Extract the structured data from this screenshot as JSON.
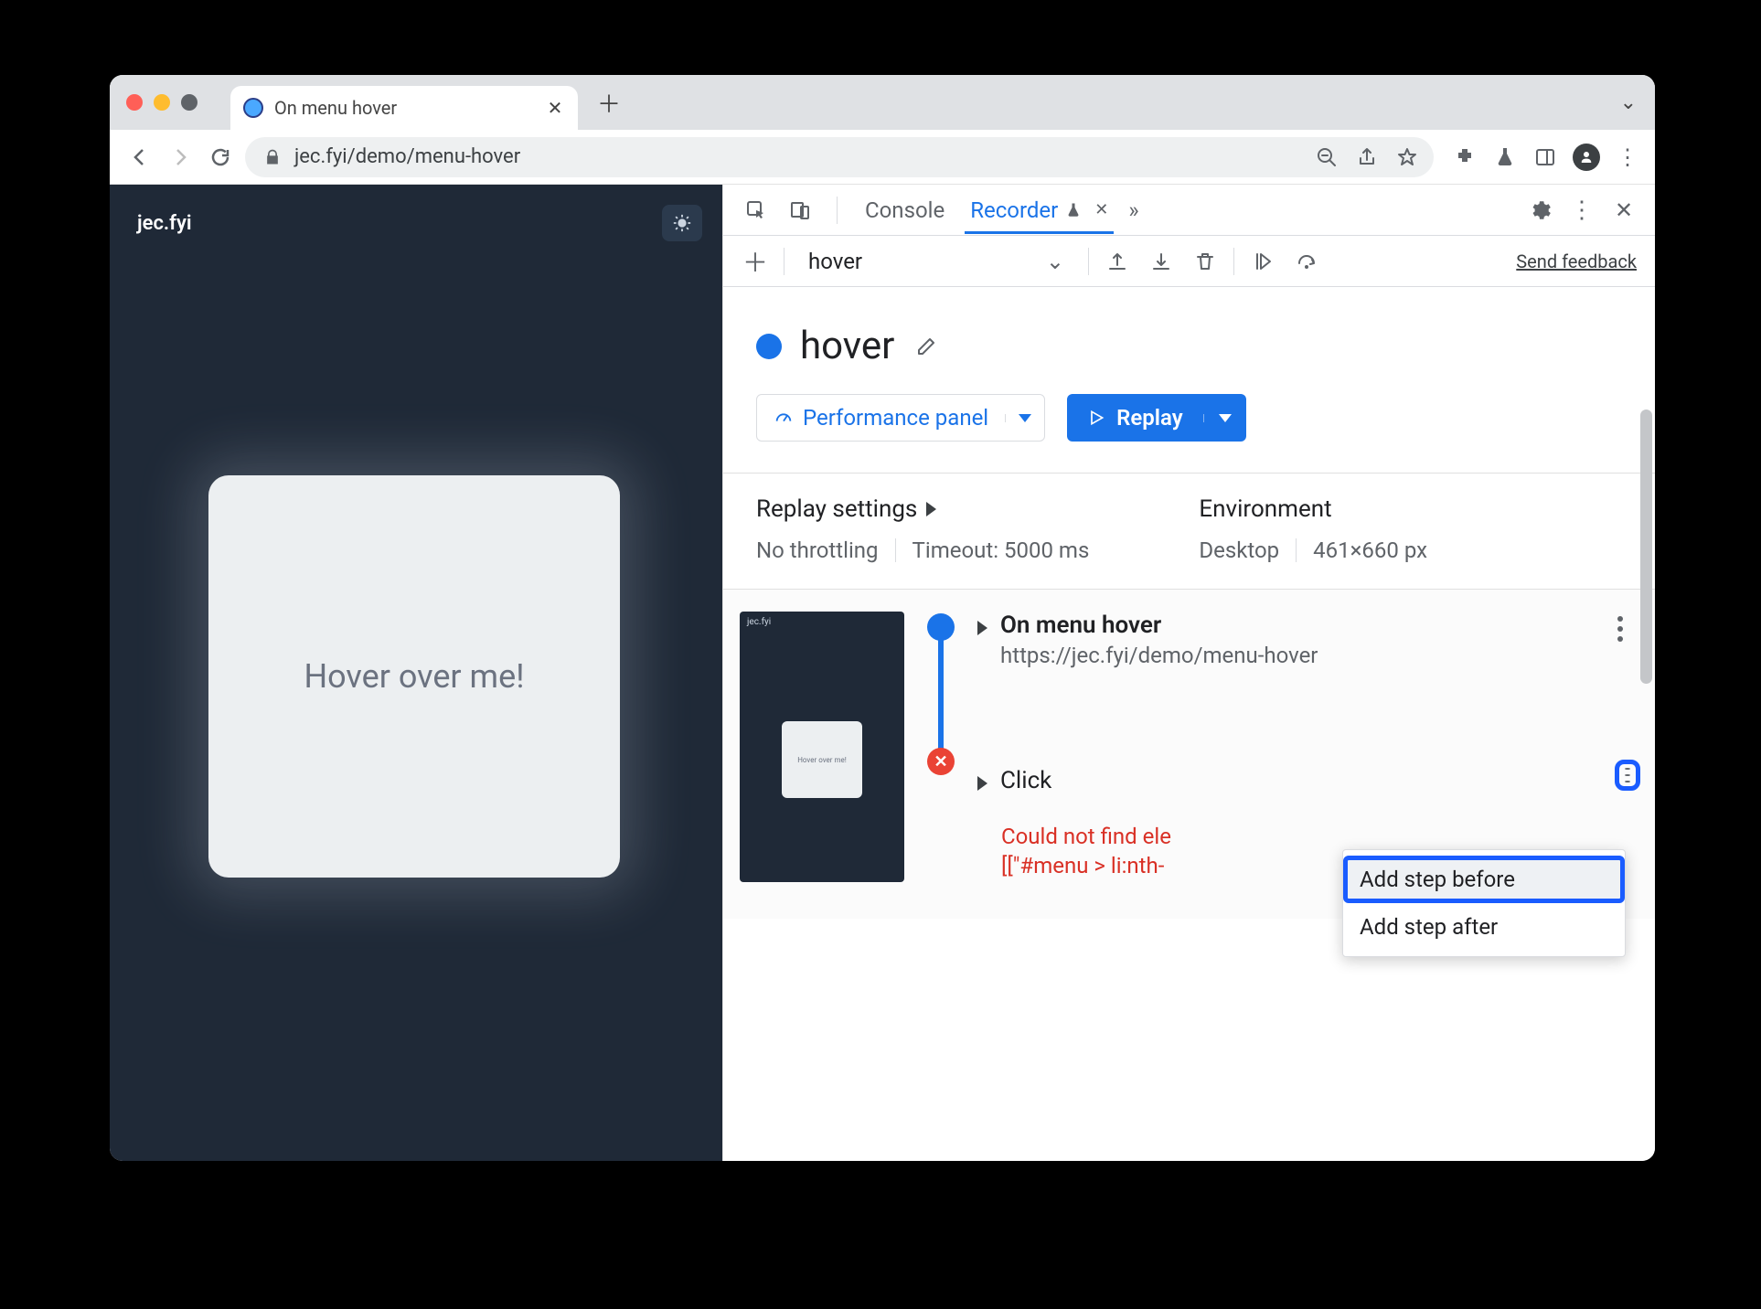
{
  "browser": {
    "tab_title": "On menu hover",
    "url": "jec.fyi/demo/menu-hover"
  },
  "page": {
    "brand": "jec.fyi",
    "card_text": "Hover over me!"
  },
  "devtools": {
    "tabs": {
      "console": "Console",
      "recorder": "Recorder"
    },
    "recorder": {
      "dropdown_value": "hover",
      "feedback": "Send feedback",
      "title": "hover",
      "perf_button": "Performance panel",
      "replay_button": "Replay",
      "settings": {
        "replay_heading": "Replay settings",
        "throttling": "No throttling",
        "timeout": "Timeout: 5000 ms",
        "env_heading": "Environment",
        "device": "Desktop",
        "viewport": "461×660 px"
      },
      "steps": [
        {
          "title": "On menu hover",
          "sub": "https://jec.fyi/demo/menu-hover"
        },
        {
          "title": "Click",
          "error_line1": "Could not find ele",
          "error_line2": "[[\"#menu > li:nth-"
        }
      ],
      "menu": {
        "before": "Add step before",
        "after": "Add step after"
      },
      "thumb": {
        "brand": "jec.fyi",
        "card": "Hover over me!"
      }
    }
  }
}
